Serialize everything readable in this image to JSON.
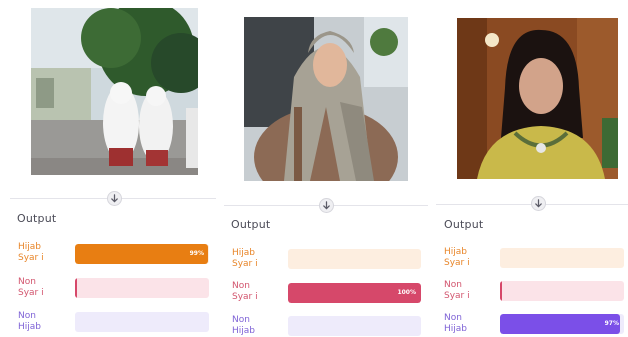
{
  "section_title": "Output",
  "class_labels": {
    "hijab": [
      "Hijab",
      "Syar i"
    ],
    "nonsyari": [
      "Non",
      "Syar i"
    ],
    "nonhijab": [
      "Non",
      "Hijab"
    ]
  },
  "colors": {
    "hijab": {
      "text": "#e8862a",
      "track": "#fdeee0",
      "fill": "#e87e12"
    },
    "nonsyari": {
      "text": "#d2556e",
      "track": "#fbe3e8",
      "fill": "#d6486a"
    },
    "nonhijab": {
      "text": "#7f63d6",
      "track": "#eeebfb",
      "fill": "#7b4fe8"
    }
  },
  "icons": {
    "expand": "arrow-down-icon"
  },
  "panels": [
    {
      "image": "two-students-in-white-hijabs-photo",
      "scores": {
        "hijab": 0.99,
        "nonsyari": 0.01,
        "nonhijab": 0.0
      },
      "score_label": "99%",
      "score_label_class": "hijab"
    },
    {
      "image": "woman-in-grey-headscarf-photo",
      "scores": {
        "hijab": 0.0,
        "nonsyari": 1.0,
        "nonhijab": 0.0
      },
      "score_label": "100%",
      "score_label_class": "nonsyari"
    },
    {
      "image": "woman-with-dark-hair-photo",
      "scores": {
        "hijab": 0.0,
        "nonsyari": 0.02,
        "nonhijab": 0.97
      },
      "score_label": "97%",
      "score_label_class": "nonhijab"
    }
  ]
}
